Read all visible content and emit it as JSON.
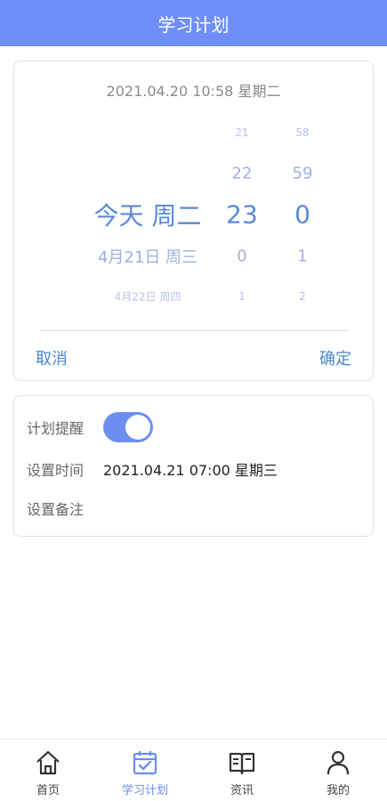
{
  "header": {
    "title": "学习计划"
  },
  "picker": {
    "current_time": "2021.04.20 10:58 星期二",
    "day_column": [
      "",
      "",
      "今天 周二",
      "4月21日 周三",
      "4月22日 周四"
    ],
    "hour_column": [
      "21",
      "22",
      "23",
      "0",
      "1"
    ],
    "minute_column": [
      "58",
      "59",
      "0",
      "1",
      "2"
    ],
    "cancel_label": "取消",
    "confirm_label": "确定"
  },
  "settings": {
    "reminder_label": "计划提醒",
    "reminder_on": true,
    "time_label": "设置时间",
    "time_value": "2021.04.21 07:00 星期三",
    "note_label": "设置备注"
  },
  "tabs": [
    {
      "label": "首页",
      "icon": "home-icon",
      "active": false
    },
    {
      "label": "学习计划",
      "icon": "calendar-check-icon",
      "active": true
    },
    {
      "label": "资讯",
      "icon": "book-icon",
      "active": false
    },
    {
      "label": "我的",
      "icon": "user-icon",
      "active": false
    }
  ],
  "colors": {
    "primary": "#6f8ff7",
    "accent_text": "#4a86d1",
    "picker_text": "#8fa3d8"
  }
}
